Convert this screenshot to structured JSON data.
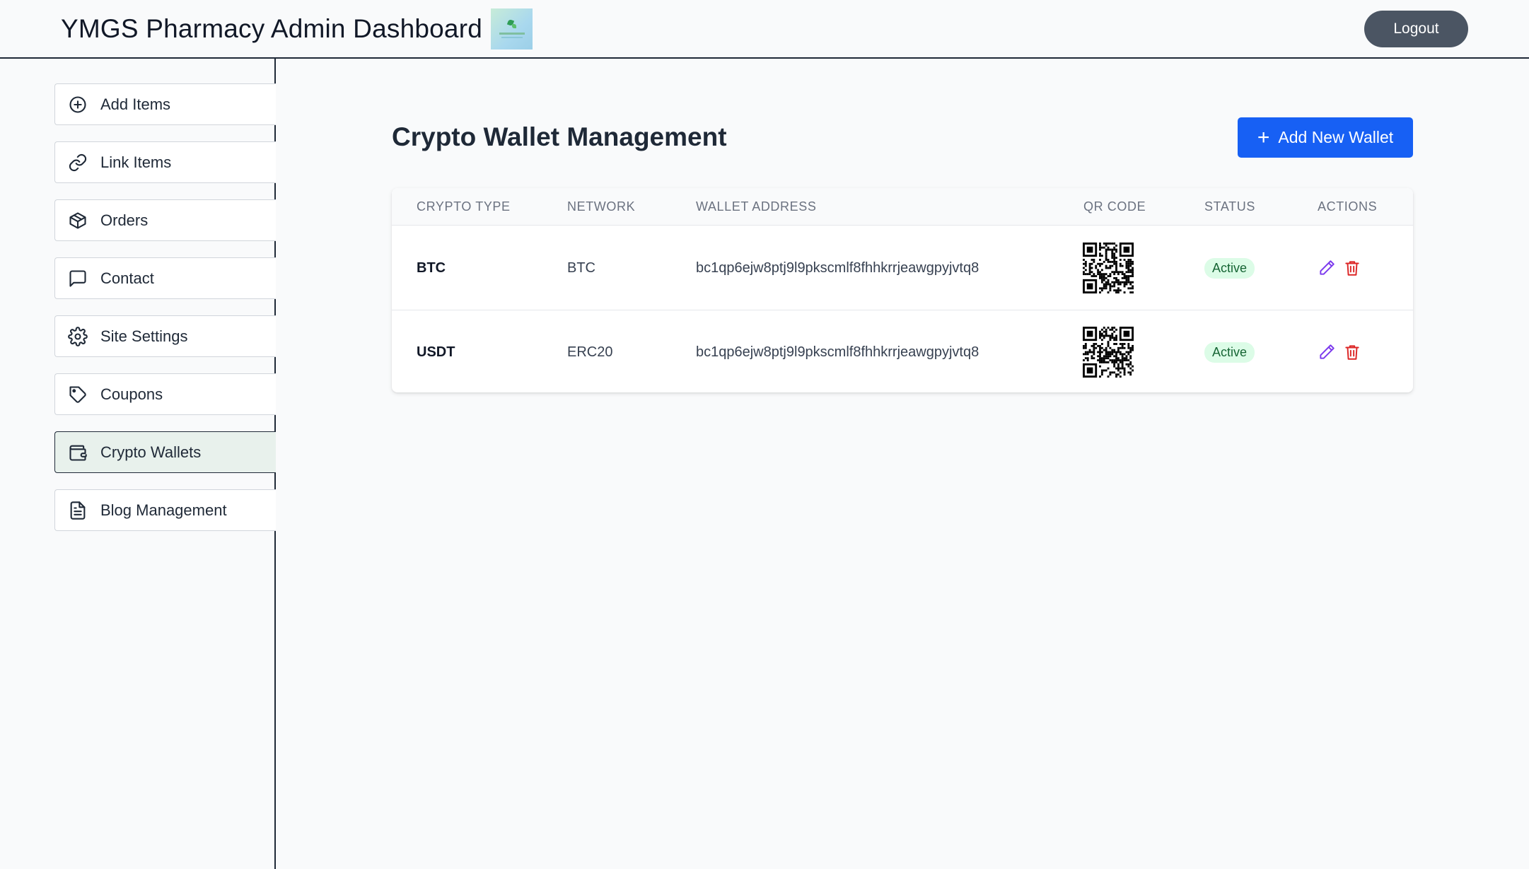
{
  "header": {
    "title": "YMGS Pharmacy Admin Dashboard",
    "logout_label": "Logout"
  },
  "sidebar": {
    "items": [
      {
        "label": "Add Items",
        "icon": "plus-circle-icon"
      },
      {
        "label": "Link Items",
        "icon": "link-icon"
      },
      {
        "label": "Orders",
        "icon": "package-icon"
      },
      {
        "label": "Contact",
        "icon": "message-square-icon"
      },
      {
        "label": "Site Settings",
        "icon": "gear-icon"
      },
      {
        "label": "Coupons",
        "icon": "tag-icon"
      },
      {
        "label": "Crypto Wallets",
        "icon": "wallet-icon",
        "active": true
      },
      {
        "label": "Blog Management",
        "icon": "file-text-icon"
      }
    ]
  },
  "main": {
    "title": "Crypto Wallet Management",
    "add_button_label": "Add New Wallet",
    "add_button_icon": "plus-icon",
    "table": {
      "columns": [
        "Crypto Type",
        "Network",
        "Wallet Address",
        "QR Code",
        "Status",
        "Actions"
      ],
      "rows": [
        {
          "type": "BTC",
          "network": "BTC",
          "address": "bc1qp6ejw8ptj9l9pkscmlf8fhhkrrjeawgpyjvtq8",
          "status": "Active"
        },
        {
          "type": "USDT",
          "network": "ERC20",
          "address": "bc1qp6ejw8ptj9l9pkscmlf8fhhkrrjeawgpyjvtq8",
          "status": "Active"
        }
      ]
    }
  },
  "colors": {
    "primary": "#1760f4",
    "logout": "#4b5563",
    "active_badge_bg": "#dcfce7",
    "active_badge_text": "#166534",
    "edit_icon": "#7c3aed",
    "delete_icon": "#dc2626"
  }
}
